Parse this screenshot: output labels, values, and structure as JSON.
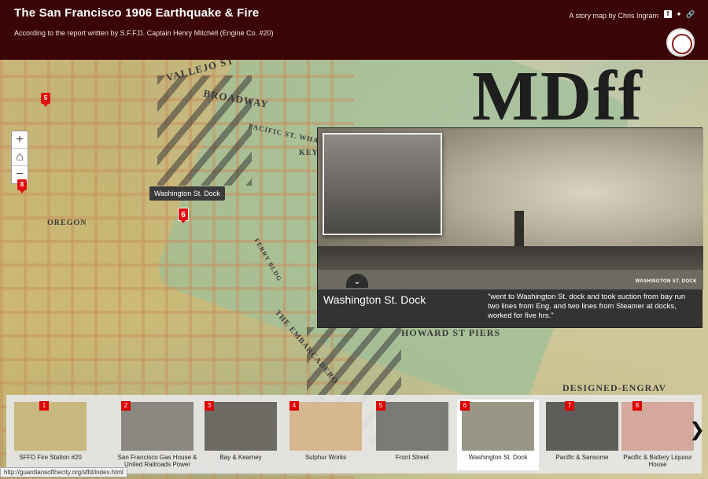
{
  "header": {
    "title": "The San Francisco 1906 Earthquake & Fire",
    "subtitle": "According to the report written by S.F.F.D. Captain Henry Mitchell (Engine Co. #20)",
    "byline": "A story map by Chris Ingram"
  },
  "map": {
    "labels": [
      "VALLEJO ST",
      "BROADWAY",
      "PACIFIC ST. WHARF",
      "KEY",
      "OREGON",
      "FERRY BLDG",
      "HOWARD ST PIERS",
      "DESIGNED-ENGRAV",
      "THE EMBARCADERO"
    ],
    "markers": [
      "5",
      "8",
      "6"
    ],
    "tooltip": "Washington St. Dock"
  },
  "zoom": {
    "in": "+",
    "home": "⌂",
    "out": "−"
  },
  "panel": {
    "title": "Washington St. Dock",
    "quote": "\"went to Washington St. dock and took suction from bay run two lines from Eng. and two lines from Steamer at docks, worked for five hrs.\"",
    "credit": "WASHINGTON ST. DOCK",
    "collapse": "⌄"
  },
  "carousel": {
    "items": [
      {
        "num": "1",
        "caption": "SFFD Fire Station #20",
        "color": "#c9b780"
      },
      {
        "num": "2",
        "caption": "San Francisco Gas House & United Railroads Power",
        "color": "#8a8780"
      },
      {
        "num": "3",
        "caption": "Bay & Kearney",
        "color": "#6d6a64"
      },
      {
        "num": "4",
        "caption": "Sulphur Works",
        "color": "#d6b790"
      },
      {
        "num": "5",
        "caption": "Front Street",
        "color": "#7c7a76"
      },
      {
        "num": "6",
        "caption": "Washington St. Dock",
        "color": "#9a9686"
      },
      {
        "num": "7",
        "caption": "Pacific & Sansome",
        "color": "#5f5d5a"
      },
      {
        "num": "8",
        "caption": "Pacific & Battery Liquour House",
        "color": "#d4a99b"
      }
    ],
    "next": "❯"
  },
  "status": "http://guardiansofthecity.org/sffd/index.html"
}
